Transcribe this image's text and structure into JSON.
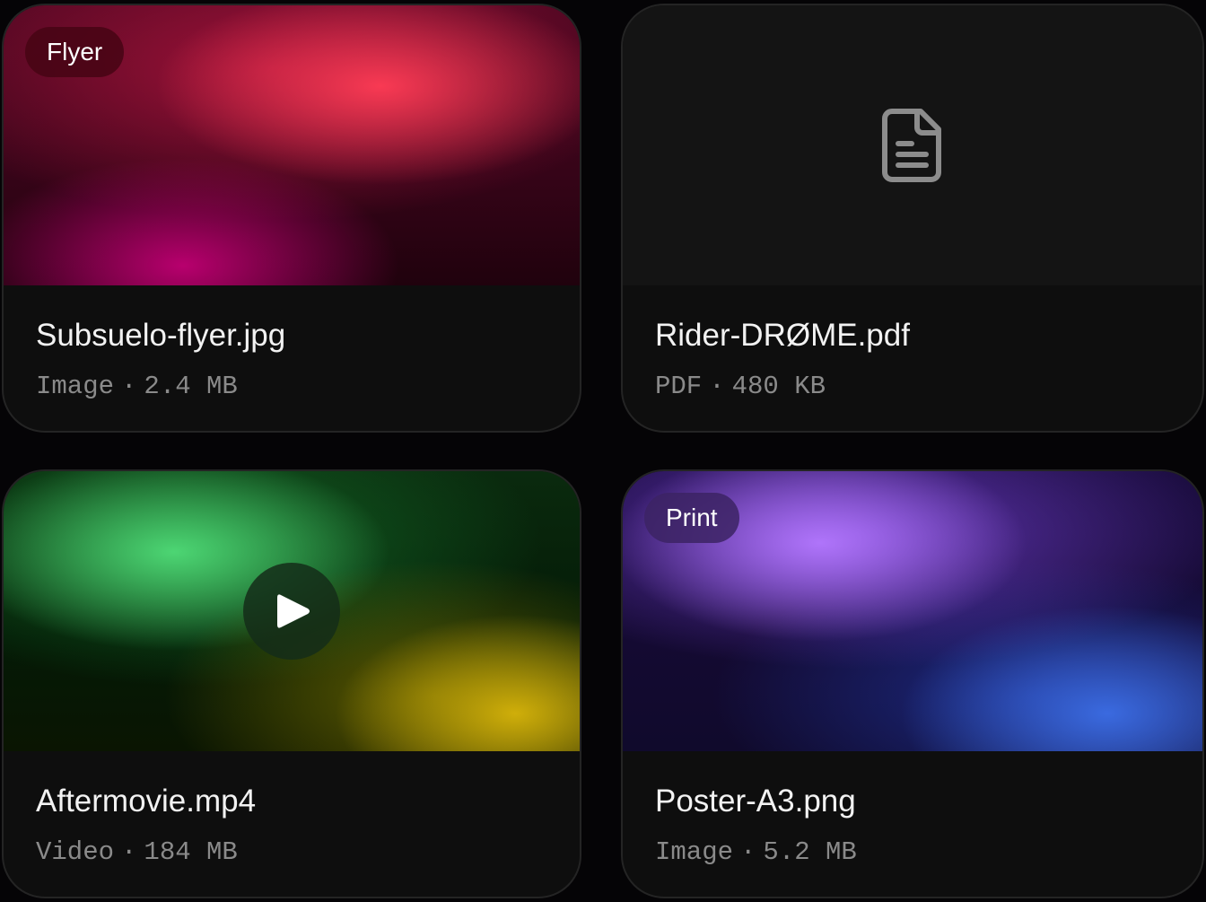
{
  "files": [
    {
      "name": "Subsuelo-flyer.jpg",
      "type": "Image",
      "separator": "·",
      "size": "2.4 MB",
      "tag": "Flyer",
      "thumbnail": "red-magenta-gradient",
      "accent_color": "#ff3a55"
    },
    {
      "name": "Rider-DRØME.pdf",
      "type": "PDF",
      "separator": "·",
      "size": "480 KB",
      "tag": "",
      "thumbnail": "document-icon",
      "icon_color": "#8c8c8c"
    },
    {
      "name": "Aftermovie.mp4",
      "type": "Video",
      "separator": "·",
      "size": "184 MB",
      "tag": "",
      "thumbnail": "green-yellow-gradient",
      "overlay_icon": "play-icon",
      "accent_color": "#50dc78"
    },
    {
      "name": "Poster-A3.png",
      "type": "Image",
      "separator": "·",
      "size": "5.2 MB",
      "tag": "Print",
      "thumbnail": "violet-blue-gradient",
      "accent_color": "#b478ff"
    }
  ],
  "colors": {
    "background": "#050406",
    "card": "#0e0e0e",
    "card_border": "#242424",
    "title_text": "#f2f2f2",
    "meta_text": "#8a8a8a"
  }
}
